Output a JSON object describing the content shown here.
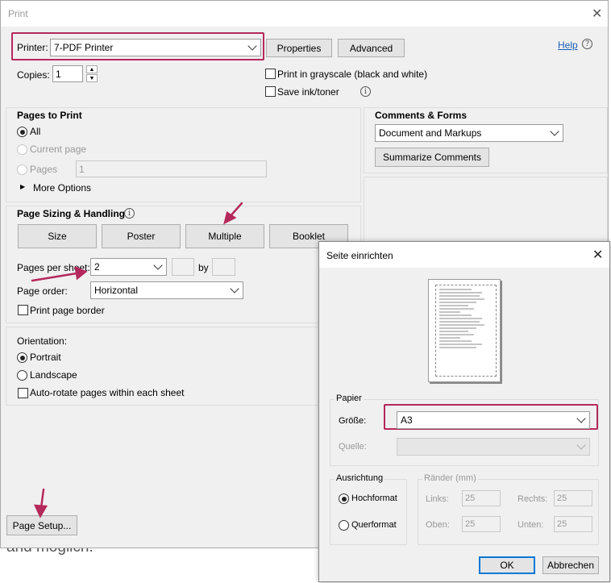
{
  "background": {
    "partial_text": "and möglich."
  },
  "print": {
    "title": "Print",
    "printer_label": "Printer:",
    "printer_value": "7-PDF Printer",
    "properties_label": "Properties",
    "advanced_label": "Advanced",
    "help_label": "Help",
    "copies_label": "Copies:",
    "copies_value": "1",
    "grayscale_label": "Print in grayscale (black and white)",
    "save_ink_label": "Save ink/toner",
    "pages_to_print": {
      "title": "Pages to Print",
      "all_label": "All",
      "current_page_label": "Current page",
      "pages_label": "Pages",
      "pages_value": "1",
      "more_options_label": "More Options"
    },
    "comments": {
      "title": "Comments & Forms",
      "selected": "Document and Markups",
      "summarize_label": "Summarize Comments"
    },
    "sizing": {
      "title": "Page Sizing & Handling",
      "tabs": [
        "Size",
        "Poster",
        "Multiple",
        "Booklet"
      ],
      "pages_per_sheet_label": "Pages per sheet:",
      "pages_per_sheet_value": "2",
      "by_label": "by",
      "page_order_label": "Page order:",
      "page_order_value": "Horizontal",
      "print_border_label": "Print page border"
    },
    "orientation": {
      "title": "Orientation:",
      "portrait_label": "Portrait",
      "landscape_label": "Landscape",
      "auto_rotate_label": "Auto-rotate pages within each sheet"
    },
    "page_setup_label": "Page Setup..."
  },
  "setup": {
    "title": "Seite einrichten",
    "paper_group_label": "Papier",
    "size_label": "Größe:",
    "size_value": "A3",
    "source_label": "Quelle:",
    "orientation_group_label": "Ausrichtung",
    "portrait_label": "Hochformat",
    "landscape_label": "Querformat",
    "margins_group_label": "Ränder (mm)",
    "left_label": "Links:",
    "left_value": "25",
    "right_label": "Rechts:",
    "right_value": "25",
    "top_label": "Oben:",
    "top_value": "25",
    "bottom_label": "Unten:",
    "bottom_value": "25",
    "ok_label": "OK",
    "cancel_label": "Abbrechen"
  },
  "colors": {
    "highlight": "#b5285b",
    "link": "#1a5fb4"
  },
  "icons": [
    "close-icon",
    "help-circle-icon",
    "info-icon",
    "chevron-down-icon",
    "triangle-right-icon",
    "spinner-up-icon",
    "spinner-down-icon",
    "annotation-arrow-icon"
  ]
}
